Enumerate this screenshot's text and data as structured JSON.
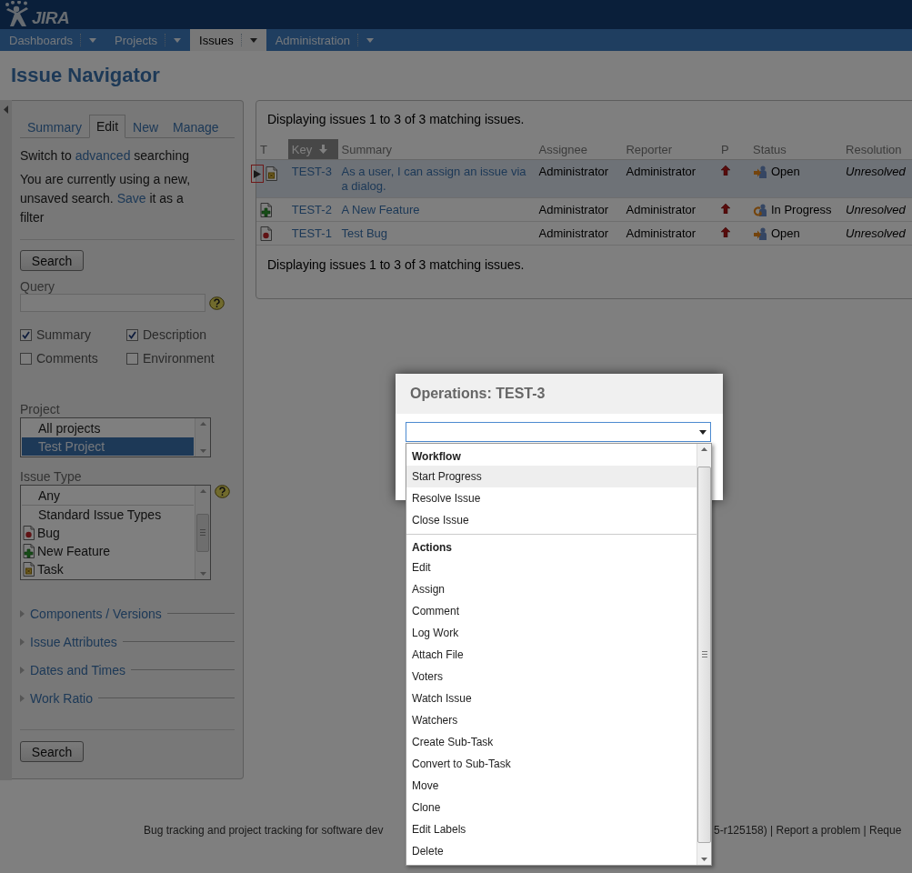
{
  "header": {
    "logo_text": "JIRA"
  },
  "nav": [
    {
      "label": "Dashboards",
      "selected": false
    },
    {
      "label": "Projects",
      "selected": false
    },
    {
      "label": "Issues",
      "selected": true
    },
    {
      "label": "Administration",
      "selected": false
    }
  ],
  "page_title": "Issue Navigator",
  "sidebar": {
    "tabs": [
      {
        "label": "Summary",
        "selected": false
      },
      {
        "label": "Edit",
        "selected": true
      },
      {
        "label": "New",
        "selected": false
      },
      {
        "label": "Manage",
        "selected": false
      }
    ],
    "switch_line": {
      "before": "Switch to ",
      "link": "advanced",
      "after": " searching"
    },
    "unsaved_note": {
      "before": "You are currently using a new, unsaved search. ",
      "link": "Save",
      "after": " it as a filter"
    },
    "top_button": "Search",
    "query_label": "Query",
    "text_fields": [
      {
        "label": "Summary",
        "checked": true
      },
      {
        "label": "Description",
        "checked": true
      },
      {
        "label": "Comments",
        "checked": false
      },
      {
        "label": "Environment",
        "checked": false
      }
    ],
    "project": {
      "label": "Project",
      "options": [
        {
          "label": "All projects",
          "selected": false
        },
        {
          "label": "Test Project",
          "selected": true
        }
      ]
    },
    "issue_type": {
      "label": "Issue Type",
      "options": [
        {
          "label": "Any",
          "kind": "plain",
          "selected": false
        },
        {
          "label": "Standard Issue Types",
          "kind": "plain",
          "selected": false
        },
        {
          "label": "Bug",
          "kind": "bug",
          "selected": false
        },
        {
          "label": "New Feature",
          "kind": "feature",
          "selected": false
        },
        {
          "label": "Task",
          "kind": "task",
          "selected": false
        }
      ]
    },
    "sections": [
      {
        "label": "Components / Versions",
        "expanded": false
      },
      {
        "label": "Issue Attributes",
        "expanded": false
      },
      {
        "label": "Dates and Times",
        "expanded": false
      },
      {
        "label": "Work Ratio",
        "expanded": false
      }
    ],
    "bottom_button": "Search"
  },
  "results": {
    "summary_top": "Displaying issues 1 to 3 of 3 matching issues.",
    "columns": [
      {
        "label": "T",
        "sorted": false
      },
      {
        "label": "Key",
        "sorted": true
      },
      {
        "label": "Summary",
        "sorted": false
      },
      {
        "label": "Assignee",
        "sorted": false
      },
      {
        "label": "Reporter",
        "sorted": false
      },
      {
        "label": "P",
        "sorted": false
      },
      {
        "label": "Status",
        "sorted": false
      },
      {
        "label": "Resolution",
        "sorted": false
      }
    ],
    "rows": [
      {
        "kind": "task",
        "key": "TEST-3",
        "summary": "As a user, I can assign an issue via a dialog.",
        "assignee": "Administrator",
        "reporter": "Administrator",
        "status": {
          "label": "Open",
          "kind": "open"
        },
        "resolution": "Unresolved",
        "selected": true
      },
      {
        "kind": "feature",
        "key": "TEST-2",
        "summary": "A New Feature",
        "assignee": "Administrator",
        "reporter": "Administrator",
        "status": {
          "label": "In Progress",
          "kind": "progress"
        },
        "resolution": "Unresolved",
        "selected": false
      },
      {
        "kind": "bug",
        "key": "TEST-1",
        "summary": "Test Bug",
        "assignee": "Administrator",
        "reporter": "Administrator",
        "status": {
          "label": "Open",
          "kind": "open"
        },
        "resolution": "Unresolved",
        "selected": false
      }
    ],
    "summary_bottom": "Displaying issues 1 to 3 of 3 matching issues."
  },
  "dialog": {
    "title": "Operations: TEST-3",
    "groups": [
      {
        "heading": "Workflow",
        "items": [
          {
            "label": "Start Progress",
            "selected": true
          },
          {
            "label": "Resolve Issue",
            "selected": false
          },
          {
            "label": "Close Issue",
            "selected": false
          }
        ]
      },
      {
        "heading": "Actions",
        "items": [
          {
            "label": "Edit",
            "selected": false
          },
          {
            "label": "Assign",
            "selected": false
          },
          {
            "label": "Comment",
            "selected": false
          },
          {
            "label": "Log Work",
            "selected": false
          },
          {
            "label": "Attach File",
            "selected": false
          },
          {
            "label": "Voters",
            "selected": false
          },
          {
            "label": "Watch Issue",
            "selected": false
          },
          {
            "label": "Watchers",
            "selected": false
          },
          {
            "label": "Create Sub-Task",
            "selected": false
          },
          {
            "label": "Convert to Sub-Task",
            "selected": false
          },
          {
            "label": "Move",
            "selected": false
          },
          {
            "label": "Clone",
            "selected": false
          },
          {
            "label": "Edit Labels",
            "selected": false
          },
          {
            "label": "Delete",
            "selected": false
          }
        ]
      }
    ]
  },
  "footer": {
    "left": "Bug tracking and project tracking for software dev",
    "right": "5-r125158) | Report a problem | Reque"
  }
}
